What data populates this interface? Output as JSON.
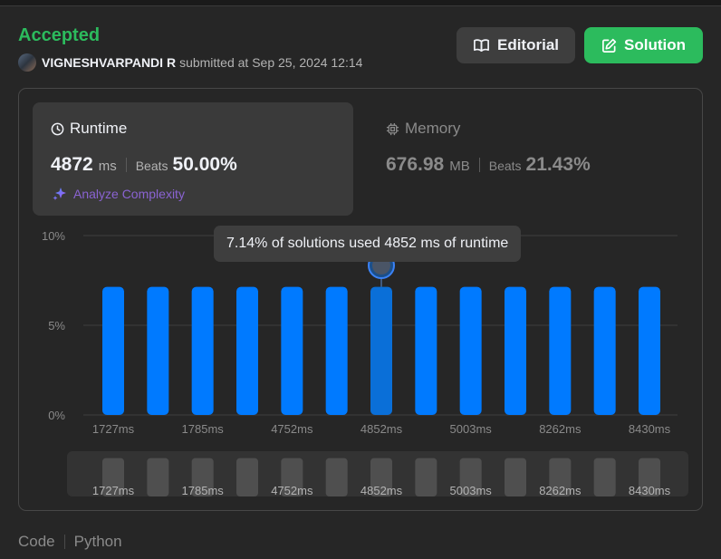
{
  "result": {
    "status": "Accepted",
    "user": "VIGNESHVARPANDI R",
    "submitted_text": "submitted at Sep 25, 2024 12:14"
  },
  "actions": {
    "editorial_label": "Editorial",
    "solution_label": "Solution"
  },
  "runtime": {
    "title": "Runtime",
    "value": "4872",
    "unit": "ms",
    "beats_label": "Beats",
    "beats": "50.00%",
    "analyze_label": "Analyze Complexity"
  },
  "memory": {
    "title": "Memory",
    "value": "676.98",
    "unit": "MB",
    "beats_label": "Beats",
    "beats": "21.43%"
  },
  "tooltip": "7.14% of solutions used 4852 ms of runtime",
  "colors": {
    "accent_green": "#2cbb5d",
    "bar_blue": "#007aff",
    "bar_highlight": "#0a6fd8",
    "analyze_purple": "#8a63d2"
  },
  "chart_data": {
    "type": "bar",
    "ylim": [
      0,
      10
    ],
    "yticks": [
      "10%",
      "5%",
      "0%"
    ],
    "ytick_values": [
      10,
      5,
      0
    ],
    "values": [
      7.14,
      7.14,
      7.14,
      7.14,
      7.14,
      7.14,
      7.14,
      7.14,
      7.14,
      7.14,
      7.14,
      7.14,
      7.14
    ],
    "highlight_index": 6,
    "xticks": [
      "1727ms",
      "1785ms",
      "4752ms",
      "4852ms",
      "5003ms",
      "8262ms",
      "8430ms"
    ],
    "xtick_bar_indices": [
      0,
      2,
      4,
      6,
      8,
      10,
      12
    ],
    "grid": true
  },
  "footer": {
    "code_label": "Code",
    "language": "Python"
  }
}
